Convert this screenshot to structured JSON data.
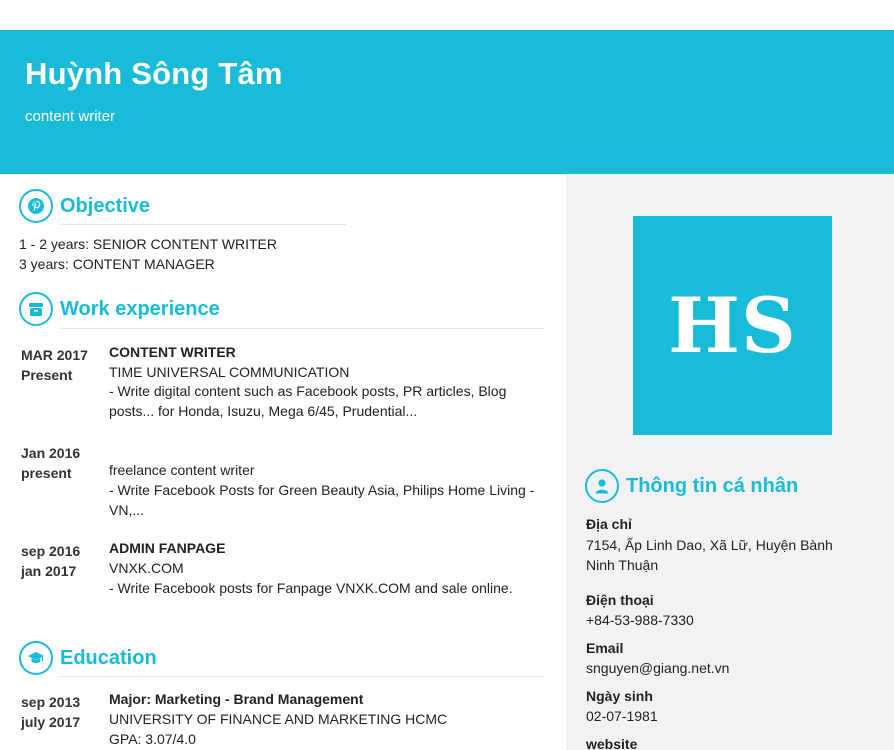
{
  "colors": {
    "accent": "#18bcd8"
  },
  "header": {
    "name": "Huỳnh Sông Tâm",
    "role": "content writer"
  },
  "avatar": {
    "initials": "HS"
  },
  "objective": {
    "title": "Objective",
    "icon": "pinterest-icon",
    "lines": [
      "1 - 2 years: SENIOR CONTENT WRITER",
      "3 years: CONTENT MANAGER"
    ]
  },
  "work": {
    "title": "Work experience",
    "icon": "briefcase-icon",
    "items": [
      {
        "date_from": "MAR 2017",
        "date_to": "Present",
        "position": "CONTENT WRITER",
        "company": "TIME UNIVERSAL COMMUNICATION",
        "desc_1": "- Write digital content such as Facebook posts, PR articles, Blog",
        "desc_2": "posts... for Honda, Isuzu, Mega 6/45, Prudential..."
      },
      {
        "date_from": "Jan 2016",
        "date_to": "present",
        "position": "",
        "company": "freelance content writer",
        "desc_1": "- Write Facebook Posts for Green Beauty Asia, Philips Home Living -",
        "desc_2": "VN,..."
      },
      {
        "date_from": "sep 2016",
        "date_to": "jan 2017",
        "position": "ADMIN FANPAGE",
        "company": "VNXK.COM",
        "desc_1": "- Write Facebook posts for Fanpage VNXK.COM and sale online.",
        "desc_2": ""
      }
    ]
  },
  "education": {
    "title": "Education",
    "icon": "graduation-cap-icon",
    "items": [
      {
        "date_from": "sep 2013",
        "date_to": "july 2017",
        "major": "Major: Marketing - Brand Management",
        "school": "UNIVERSITY OF FINANCE AND MARKETING HCMC",
        "gpa": "GPA: 3.07/4.0"
      }
    ]
  },
  "personal": {
    "title": "Thông tin cá nhân",
    "icon": "user-icon",
    "address_label": "Địa chỉ",
    "address_1": "7154, Ấp Linh Dao, Xã Lữ, Huyện Bành",
    "address_2": "Ninh Thuận",
    "phone_label": "Điện thoại",
    "phone": "+84-53-988-7330",
    "email_label": "Email",
    "email": "snguyen@giang.net.vn",
    "dob_label": "Ngày sinh",
    "dob": "02-07-1981",
    "website_label": "website"
  }
}
